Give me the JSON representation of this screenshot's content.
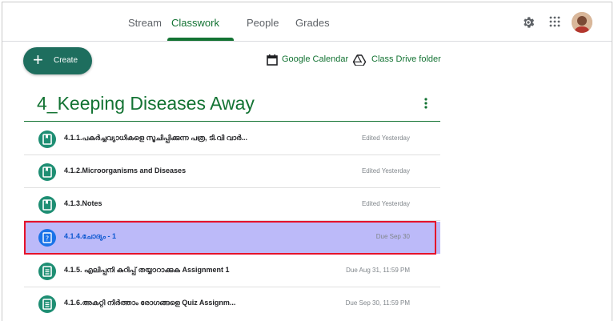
{
  "nav": {
    "tabs": [
      {
        "label": "Stream",
        "active": false
      },
      {
        "label": "Classwork",
        "active": true
      },
      {
        "label": "People",
        "active": false
      },
      {
        "label": "Grades",
        "active": false
      }
    ],
    "icons": [
      "settings-icon",
      "apps-grid-icon",
      "avatar"
    ]
  },
  "toolbar": {
    "create_label": "Create",
    "calendar_label": "Google Calendar",
    "drive_label": "Class Drive folder"
  },
  "topic": {
    "title": "4_Keeping Diseases Away",
    "items": [
      {
        "title": "4.1.1.പകർച്ചവ്യാധികളെ സൂചിപ്പിക്കുന്ന പത്ര, ടി.വി വാർ...",
        "status": "Edited Yesterday",
        "icon": "material-icon",
        "selected": false
      },
      {
        "title": "4.1.2.Microorganisms and Diseases",
        "status": "Edited Yesterday",
        "icon": "material-icon",
        "selected": false
      },
      {
        "title": "4.1.3.Notes",
        "status": "Edited Yesterday",
        "icon": "material-icon",
        "selected": false
      },
      {
        "title": "4.1.4.ചോദ്യം - 1",
        "status": "Due Sep 30",
        "icon": "question-icon",
        "selected": true
      },
      {
        "title": "4.1.5. എലിപ്പനി കുറിപ്പ് തയ്യാറാക്കുക Assignment 1",
        "status": "Due Aug 31, 11:59 PM",
        "icon": "assignment-icon",
        "selected": false
      },
      {
        "title": "4.1.6.അകറ്റി നിർത്താം രോഗങ്ങളെ Quiz Assignm...",
        "status": "Due Sep 30, 11:59 PM",
        "icon": "assignment-icon",
        "selected": false
      }
    ]
  },
  "colors": {
    "accent": "#137333",
    "create_bg": "#1e6e5e",
    "selected_row_bg": "#bcbaf9",
    "highlight_border": "#e5132b"
  }
}
